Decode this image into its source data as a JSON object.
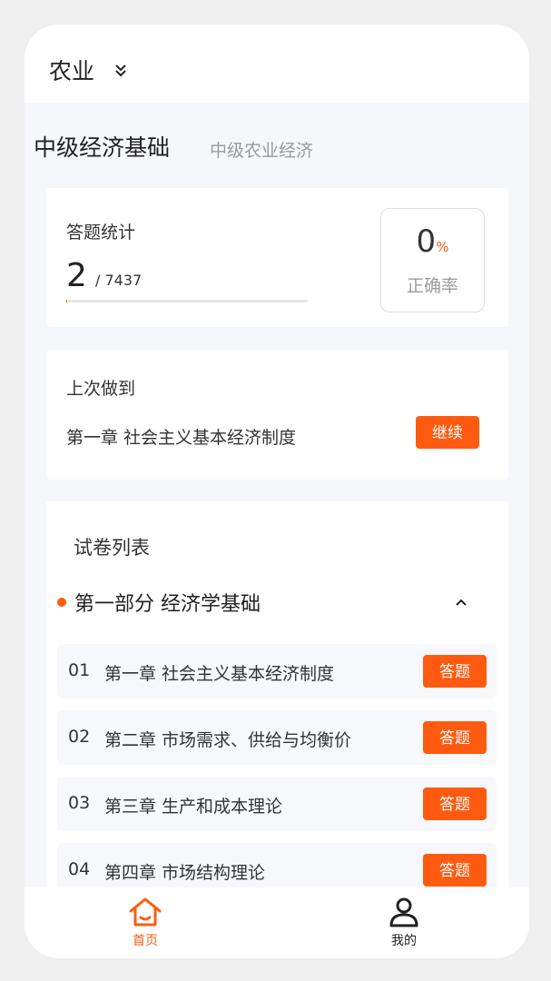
{
  "header": {
    "category": "农业"
  },
  "subject": {
    "main": "中级经济基础",
    "sub": "中级农业经济"
  },
  "stats": {
    "label": "答题统计",
    "answered": "2",
    "total": "/ 7437",
    "progress_fraction": 0.0003,
    "rate_value": "0",
    "rate_unit": "%",
    "rate_label": "正确率"
  },
  "last": {
    "label": "上次做到",
    "chapter": "第一章 社会主义基本经济制度",
    "continue_label": "继续"
  },
  "papers": {
    "heading": "试卷列表",
    "section": "第一部分 经济学基础",
    "items": [
      {
        "no": "01",
        "title": "第一章 社会主义基本经济制度",
        "action": "答题"
      },
      {
        "no": "02",
        "title": "第二章 市场需求、供给与均衡价",
        "action": "答题"
      },
      {
        "no": "03",
        "title": "第三章 生产和成本理论",
        "action": "答题"
      },
      {
        "no": "04",
        "title": "第四章 市场结构理论",
        "action": "答题"
      }
    ]
  },
  "tabs": {
    "home": "首页",
    "mine": "我的"
  },
  "colors": {
    "accent": "#ff5a10",
    "background": "#f6f7fb"
  }
}
